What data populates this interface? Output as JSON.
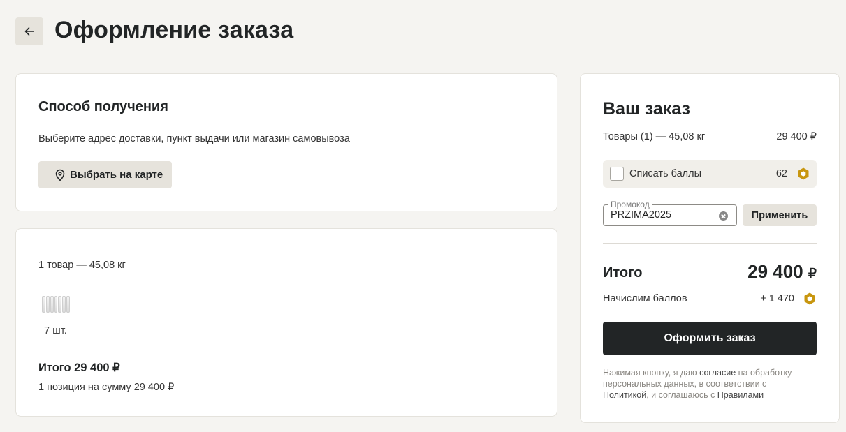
{
  "header": {
    "title": "Оформление заказа"
  },
  "delivery": {
    "title": "Способ получения",
    "description": "Выберите адрес доставки, пункт выдачи или магазин самовывоза",
    "map_button": "Выбрать на карте"
  },
  "items": {
    "count_weight": "1 товар — 45,08 кг",
    "products": [
      {
        "quantity": "7 шт."
      }
    ],
    "total": "Итого 29 400 ₽",
    "summary": "1 позиция на сумму 29 400 ₽"
  },
  "order": {
    "title": "Ваш заказ",
    "goods_label": "Товары (1) — 45,08 кг",
    "goods_price": "29 400 ₽",
    "points": {
      "label": "Списать баллы",
      "value": "62",
      "checked": false
    },
    "promo": {
      "label": "Промокод",
      "value": "PRZIMA2025",
      "apply_button": "Применить"
    },
    "total_label": "Итого",
    "total_amount": "29 400",
    "total_currency": "₽",
    "bonus_label": "Начислим баллов",
    "bonus_value": "+ 1 470",
    "submit_button": "Оформить заказ",
    "consent": {
      "part1": "Нажимая кнопку, я даю ",
      "link1": "согласие",
      "part2": " на обработку персональных данных, в соответствии с ",
      "link2": "Политикой",
      "part3": ", и соглашаюсь с ",
      "link3": "Правилами"
    }
  },
  "colors": {
    "accent_dark": "#222526",
    "button_light": "#e6e3dc",
    "points_icon": "#c8960f",
    "background": "#f5f4f1"
  },
  "icons": {
    "back": "arrow-left-icon",
    "map": "map-pin-icon",
    "points": "hexagon-coin-icon",
    "clear": "clear-circle-icon"
  }
}
